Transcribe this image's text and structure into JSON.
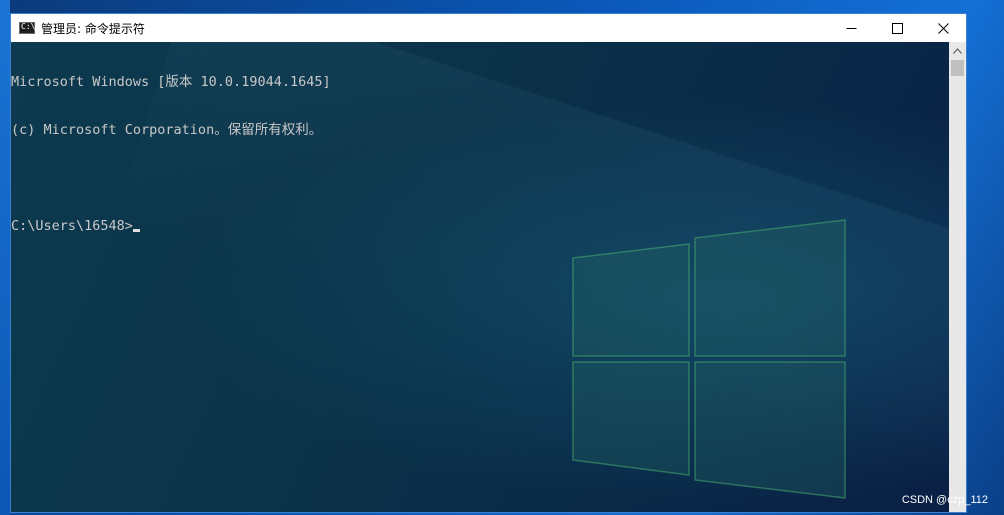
{
  "window": {
    "title": "管理员: 命令提示符",
    "app_icon_glyph": "C:\\"
  },
  "controls": {
    "minimize_glyph": "—",
    "maximize_glyph": "☐",
    "close_glyph": "✕"
  },
  "console": {
    "lines": [
      "Microsoft Windows [版本 10.0.19044.1645]",
      "(c) Microsoft Corporation。保留所有权利。",
      "",
      "C:\\Users\\16548>"
    ]
  },
  "watermark": {
    "text": "CSDN @czp_112"
  },
  "colors": {
    "console_text": "#c8c8c8",
    "desktop_blue": "#0a57b8",
    "logo_green": "#3fa06a"
  }
}
